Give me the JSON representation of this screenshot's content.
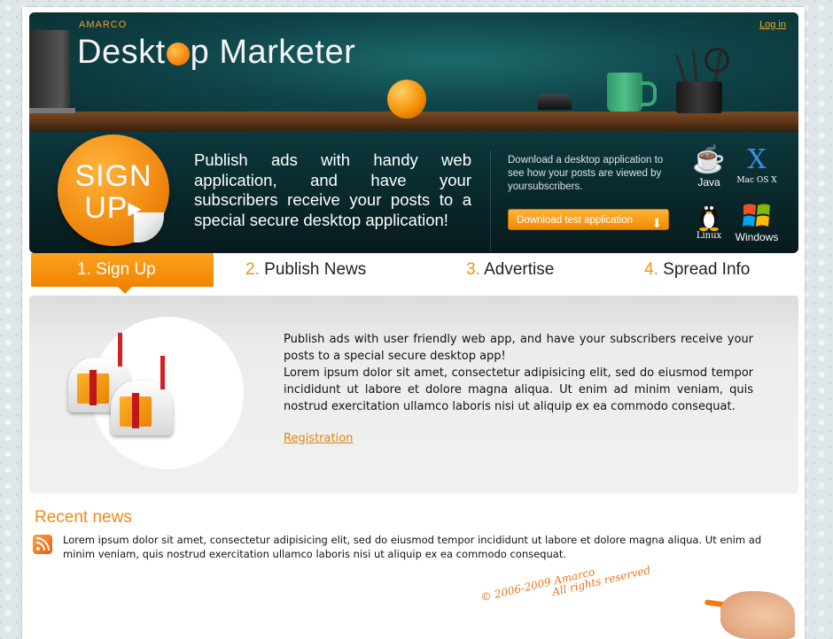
{
  "header": {
    "brand_small": "AMARCO",
    "brand_part1": "Deskt",
    "brand_part2": "p Marketer",
    "login": "Log in"
  },
  "promo": {
    "signup_line1": "SIGN",
    "signup_line2": "UP",
    "text": "Publish ads with handy web application, and have your subscribers receive your posts to a special secure desktop application!",
    "download_text": "Download a desktop application to see how your posts are viewed by yoursubscribers.",
    "download_button": "Download test application",
    "platforms": [
      {
        "name": "Java",
        "icon": "java-icon"
      },
      {
        "name": "Mac OS X",
        "icon": "macos-icon"
      },
      {
        "name": "Linux",
        "icon": "linux-icon"
      },
      {
        "name": "Windows",
        "icon": "windows-icon"
      }
    ]
  },
  "steps": [
    {
      "num": "1.",
      "label": "Sign Up",
      "active": true
    },
    {
      "num": "2.",
      "label": "Publish News",
      "active": false
    },
    {
      "num": "3.",
      "label": "Advertise",
      "active": false
    },
    {
      "num": "4.",
      "label": "Spread Info",
      "active": false
    }
  ],
  "content": {
    "line1": "Publish ads with user friendly web app, and have your subscribers receive your posts to a special secure desktop app!",
    "line2": "Lorem ipsum dolor sit amet, consectetur adipisicing elit, sed do eiusmod tempor incididunt ut labore et dolore magna aliqua. Ut enim ad minim veniam, quis nostrud exercitation ullamco laboris nisi ut aliquip ex ea commodo consequat.",
    "link": "Registration"
  },
  "news": {
    "title": "Recent news",
    "text": "Lorem ipsum dolor sit amet, consectetur adipisicing elit, sed do eiusmod tempor incididunt ut labore et dolore magna aliqua. Ut enim ad minim veniam, quis nostrud exercitation ullamco laboris nisi ut aliquip ex ea commodo consequat."
  },
  "footer": {
    "line1": "© 2006-2009 Amarco",
    "line2": "All rights reserved"
  },
  "colors": {
    "accent": "#f39019",
    "header_bg": "#0f4a4e",
    "content_bg": "#ececec"
  }
}
